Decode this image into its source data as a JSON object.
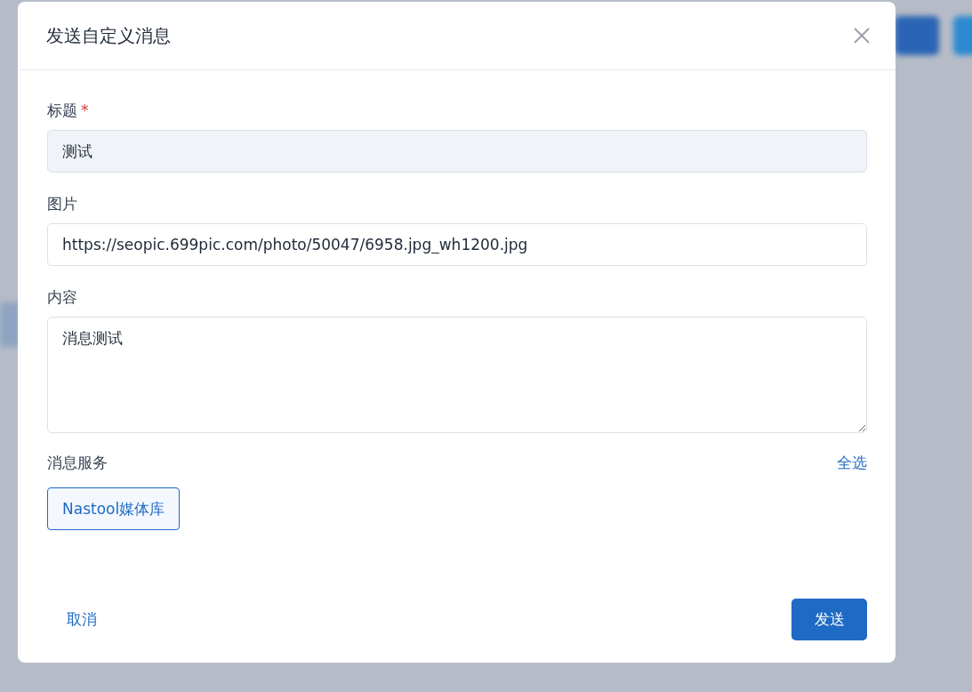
{
  "dialog": {
    "title": "发送自定义消息",
    "fields": [
      {
        "kind": "input",
        "label": "标题",
        "required_mark": "*",
        "disabled": true,
        "value": "测试"
      },
      {
        "kind": "input",
        "label": "图片",
        "disabled": false,
        "value": "https://seopic.699pic.com/photo/50047/6958.jpg_wh1200.jpg"
      },
      {
        "kind": "textarea",
        "label": "内容",
        "disabled": false,
        "value": "消息测试"
      }
    ],
    "services": {
      "label": "消息服务",
      "select_all": "全选",
      "items": [
        {
          "label": "Nastool媒体库",
          "selected": true
        }
      ]
    },
    "cancel": "取消",
    "submit": "发送"
  }
}
